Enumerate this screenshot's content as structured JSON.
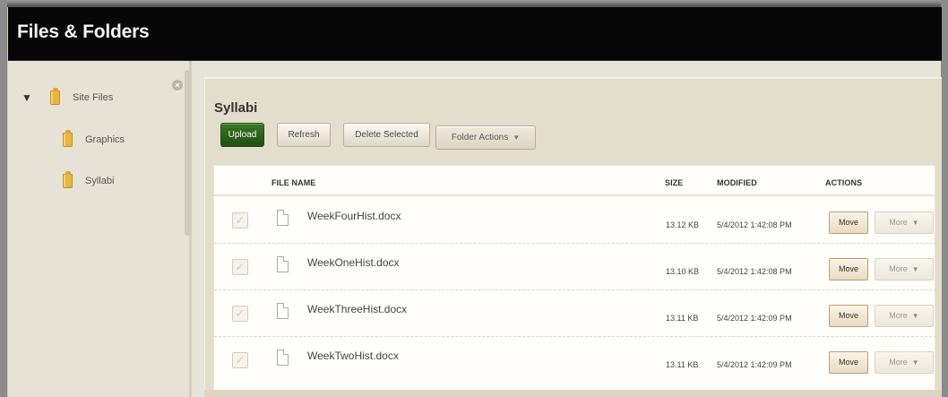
{
  "app": {
    "title": "Files & Folders"
  },
  "sidebar": {
    "items": [
      {
        "label": "Site Files",
        "expanded": true,
        "icon": "folder-icon"
      },
      {
        "label": "Graphics",
        "icon": "folder-icon"
      },
      {
        "label": "Syllabi",
        "icon": "folder-icon"
      }
    ],
    "close_icon": "close-icon"
  },
  "main": {
    "title": "Syllabi",
    "buttons": {
      "upload": "Upload",
      "refresh": "Refresh",
      "delete_selected": "Delete Selected",
      "folder_actions": "Folder Actions"
    },
    "table": {
      "headers": [
        "FILE NAME",
        "SIZE",
        "MODIFIED",
        "ACTIONS"
      ],
      "rows": [
        {
          "name": "WeekFourHist.docx",
          "size": "13.12 KB",
          "modified": "5/4/2012 1:42:08 PM",
          "move": "Move",
          "more": "More"
        },
        {
          "name": "WeekOneHist.docx",
          "size": "13.10 KB",
          "modified": "5/4/2012 1:42:08 PM",
          "move": "Move",
          "more": "More"
        },
        {
          "name": "WeekThreeHist.docx",
          "size": "13.11 KB",
          "modified": "5/4/2012 1:42:09 PM",
          "move": "Move",
          "more": "More"
        },
        {
          "name": "WeekTwoHist.docx",
          "size": "13.11 KB",
          "modified": "5/4/2012 1:42:09 PM",
          "move": "Move",
          "more": "More"
        }
      ]
    }
  },
  "colors": {
    "header": "#070707",
    "panel": "#e3ddcc",
    "upload": "#2d6419",
    "folder": "#e7b63e"
  }
}
